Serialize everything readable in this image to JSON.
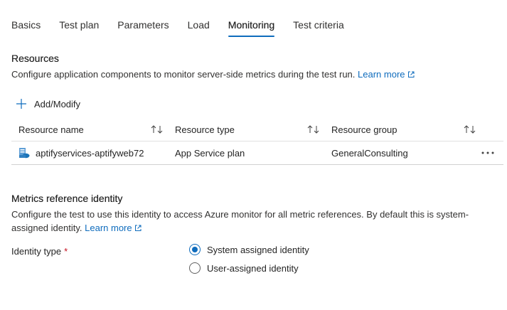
{
  "tabs": [
    {
      "label": "Basics"
    },
    {
      "label": "Test plan"
    },
    {
      "label": "Parameters"
    },
    {
      "label": "Load"
    },
    {
      "label": "Monitoring",
      "active": true
    },
    {
      "label": "Test criteria"
    }
  ],
  "resources": {
    "title": "Resources",
    "description": "Configure application components to monitor server-side metrics during the test run.",
    "learn_more": "Learn more",
    "add_modify": "Add/Modify",
    "columns": [
      "Resource name",
      "Resource type",
      "Resource group"
    ],
    "rows": [
      {
        "name": "aptifyservices-aptifyweb72",
        "type": "App Service plan",
        "group": "GeneralConsulting"
      }
    ]
  },
  "identity": {
    "title": "Metrics reference identity",
    "description": "Configure the test to use this identity to access Azure monitor for all metric references. By default this is system-assigned identity.",
    "learn_more": "Learn more",
    "field_label": "Identity type",
    "required_mark": "*",
    "options": [
      {
        "label": "System assigned identity",
        "selected": true
      },
      {
        "label": "User-assigned identity",
        "selected": false
      }
    ]
  },
  "colors": {
    "accent": "#0f6cbd",
    "required": "#c50f1f"
  }
}
